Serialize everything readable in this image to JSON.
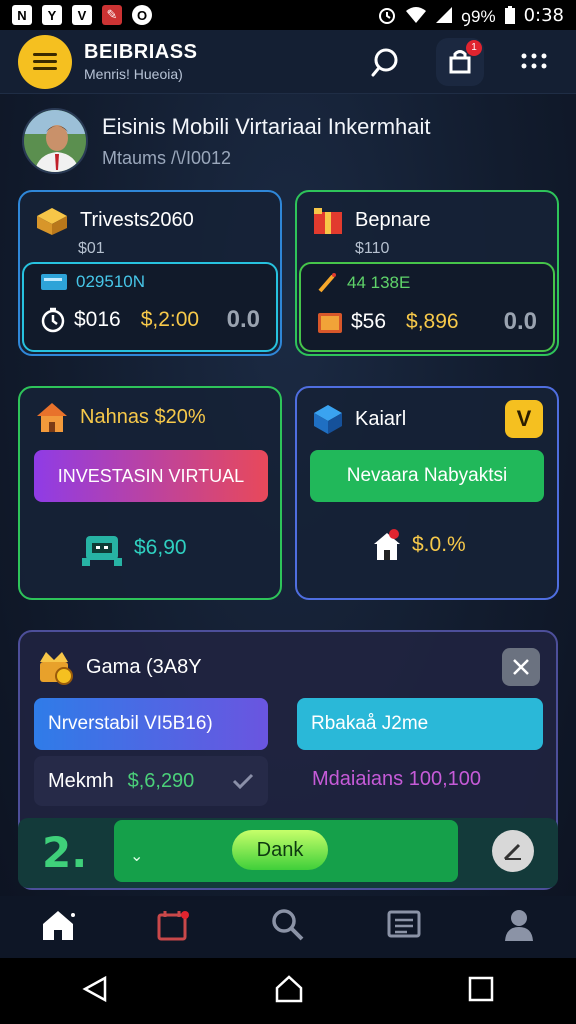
{
  "status_bar": {
    "left_icons": [
      "N",
      "Y",
      "V",
      "✎",
      "O"
    ],
    "battery_text": "ꝯ9%",
    "clock": "0:38"
  },
  "header": {
    "title": "BEIBRIASS",
    "subtitle": "Menris! Hueoia)",
    "cart_badge": "1"
  },
  "profile": {
    "name": "Eisinis Mobili Virtariaai Inkermhait",
    "subtitle": "Mtaums /\\/I0012"
  },
  "cards": {
    "invest": {
      "title": "Trivests2060",
      "sub": "$01",
      "inner_label": "029510N",
      "v1": "$016",
      "v2": "$,2:00",
      "v3": "0.0"
    },
    "bepnare": {
      "title": "Bepnare",
      "sub": "$110",
      "inner_label": "44 138E",
      "v1": "$56",
      "v2": "$,896",
      "v3": "0.0"
    },
    "nahnas": {
      "title": "Nahnas $20%",
      "button": "INVESTASIN VIRTUAL",
      "value": "$6,90"
    },
    "kaiari": {
      "title": "Kaiarl",
      "button": "Nevaara Nabyaktsi",
      "value": "$.0.%"
    },
    "game": {
      "title": "Gama (3A8Y",
      "btn_left": "Nrverstabil VI5B16)",
      "btn_right": "Rbakaå J2me",
      "row_left_label": "Mekmh",
      "row_left_value": "$,6,290",
      "row_right": "Mdaiaians 100,100",
      "bottom_left_glyph": "2.",
      "bottom_button": "Dank",
      "bottom_caret": "⌄"
    }
  },
  "colors": {
    "accent_yellow": "#f5c020",
    "card_blue": "#2f87d8",
    "card_green": "#2ec45a",
    "card_purple": "#6a4fd1",
    "gradient_pink": "#e8495a",
    "gradient_purple": "#8f3ce6"
  },
  "icons": [
    "search-icon",
    "cart-icon",
    "more-icon",
    "home-icon",
    "calendar-icon",
    "search-nav-icon",
    "news-icon",
    "user-icon",
    "back-icon",
    "home-sys-icon",
    "recents-icon"
  ]
}
